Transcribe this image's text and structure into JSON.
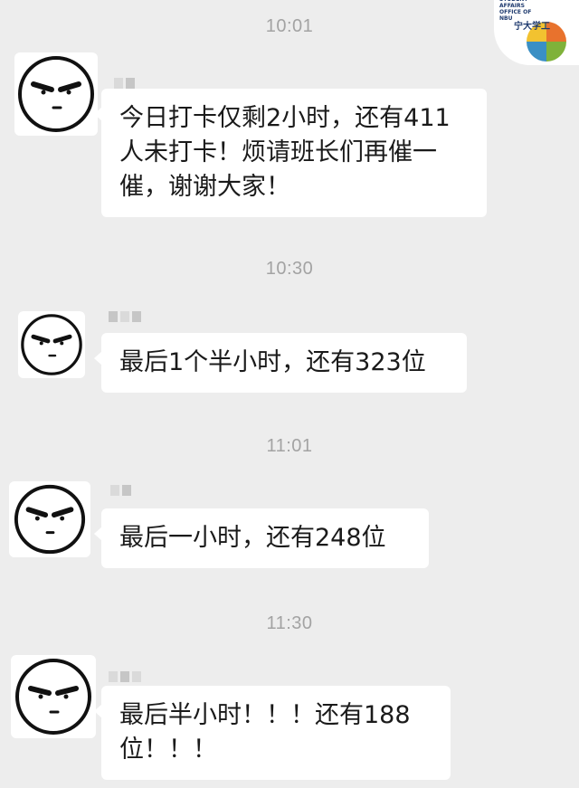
{
  "messages": [
    {
      "time": "10:01",
      "text": "今日打卡仅剩2小时，还有411人未打卡！烦请班长们再催一催，谢谢大家！"
    },
    {
      "time": "10:30",
      "text": "最后1个半小时，还有323位"
    },
    {
      "time": "11:01",
      "text": "最后一小时，还有248位"
    },
    {
      "time": "11:30",
      "text": "最后半小时！！！还有188位！！！"
    }
  ],
  "watermark": {
    "org_text": "STUDENT AFFAIRS OFFICE OF NBU",
    "cn_text": "宁大学工"
  },
  "colors": {
    "background": "#ededed",
    "bubble": "#ffffff",
    "timestamp": "#a3a3a3"
  }
}
